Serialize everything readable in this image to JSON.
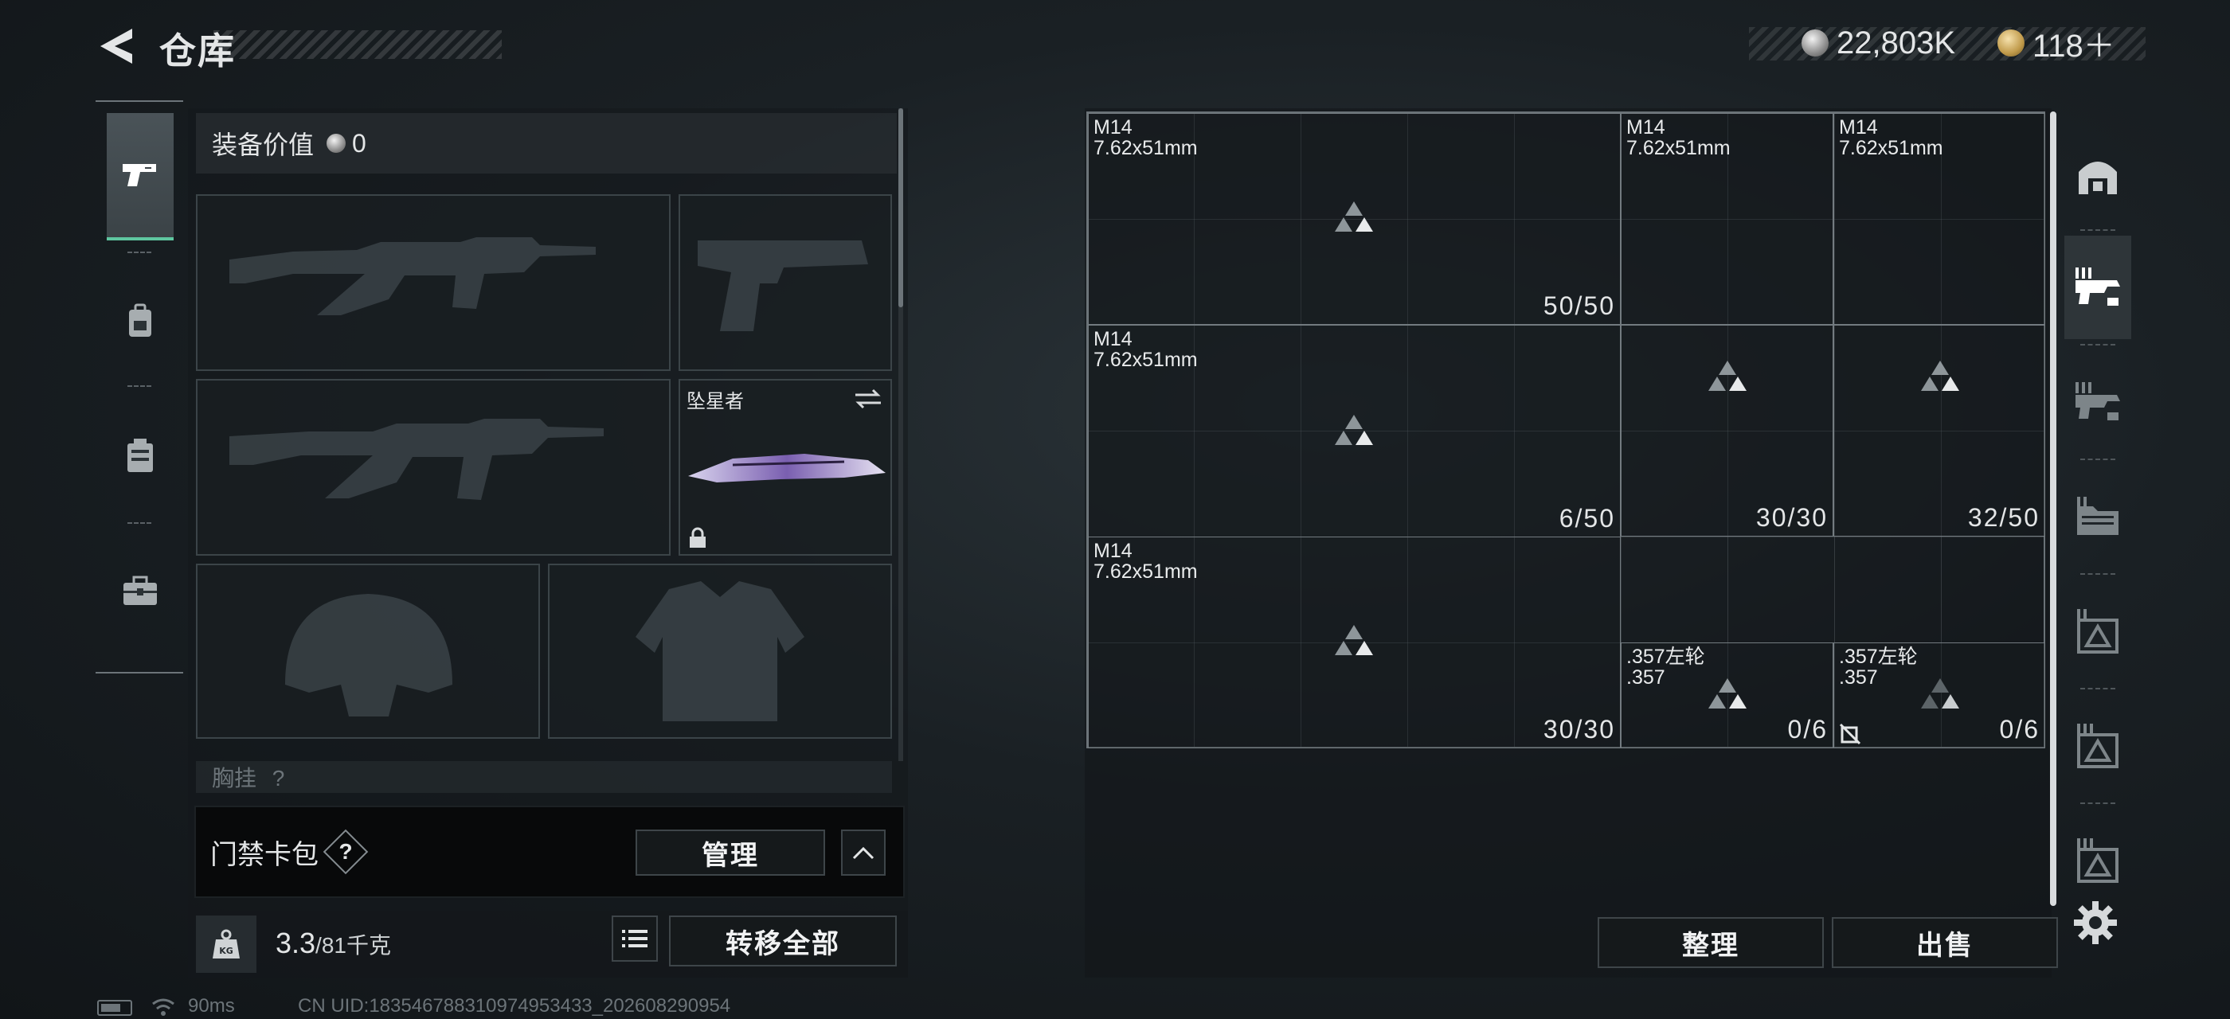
{
  "header": {
    "title": "仓库",
    "currencies": [
      {
        "icon": "silver-coin-icon",
        "value": "22,803K"
      },
      {
        "icon": "gold-coin-icon",
        "value": "118＋"
      }
    ]
  },
  "left_tabs": [
    {
      "icon": "pistol-icon",
      "active": true
    },
    {
      "icon": "backpack-icon",
      "active": false
    },
    {
      "icon": "chest-rig-icon",
      "active": false
    },
    {
      "icon": "toolbox-icon",
      "active": false
    }
  ],
  "equipment": {
    "value_label": "装备价值",
    "value": "0",
    "melee_name": "坠星者",
    "chest_label": "胸挂",
    "chest_hint": "?"
  },
  "keycard": {
    "label": "门禁卡包",
    "help": "?",
    "manage_label": "管理"
  },
  "footer_left": {
    "weight_current": "3.3",
    "weight_total": "/81千克",
    "transfer_all_label": "转移全部"
  },
  "storage": {
    "items": [
      {
        "name": "M14",
        "sub": "7.62x51mm",
        "count": "50/50"
      },
      {
        "name": "M14",
        "sub": "7.62x51mm",
        "count": ""
      },
      {
        "name": "M14",
        "sub": "7.62x51mm",
        "count": ""
      },
      {
        "name": "M14",
        "sub": "7.62x51mm",
        "count": "6/50"
      },
      {
        "name": "",
        "sub": "",
        "count": "30/30"
      },
      {
        "name": "",
        "sub": "",
        "count": "32/50"
      },
      {
        "name": "M14",
        "sub": "7.62x51mm",
        "count": "30/30"
      },
      {
        "name": ".357左轮",
        "sub": ".357",
        "count": "0/6"
      },
      {
        "name": ".357左轮",
        "sub": ".357",
        "count": "0/6"
      }
    ],
    "sort_label": "整理",
    "sell_label": "出售"
  },
  "status_bar": {
    "ping": "90ms",
    "uid": "CN UID:18354678831097495343​3_202608290954"
  },
  "colors": {
    "accent": "#5fc7a0",
    "panel": "#15191b",
    "border": "#3e4549"
  }
}
